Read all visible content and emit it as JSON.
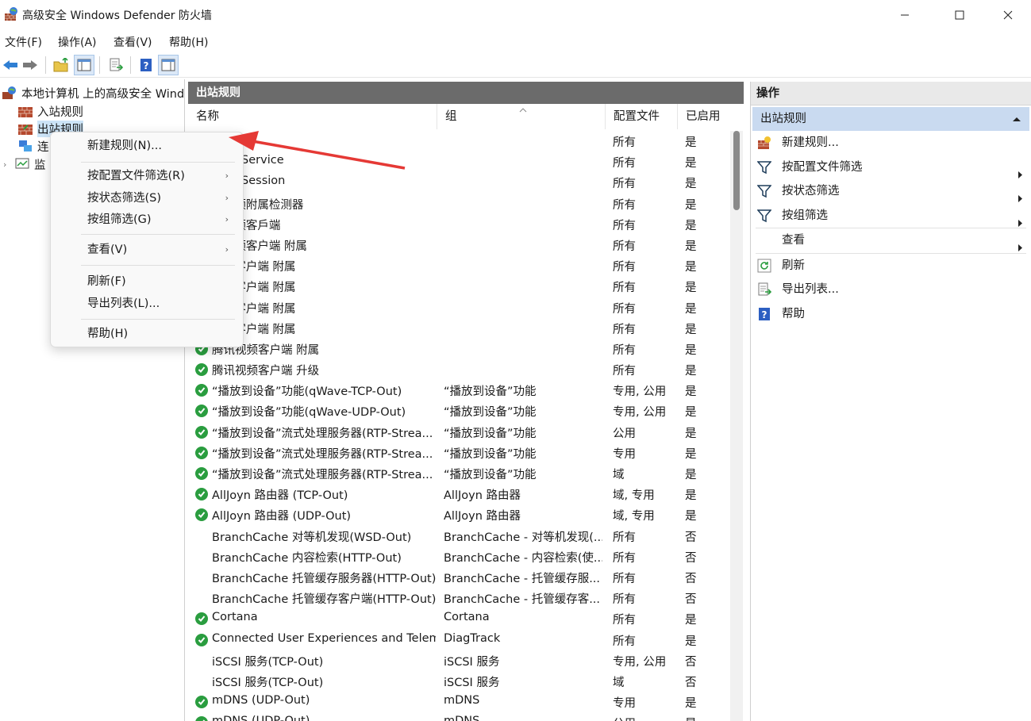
{
  "window": {
    "title": "高级安全 Windows Defender 防火墙",
    "minimize_icon": "minimize-icon",
    "maximize_icon": "maximize-icon",
    "close_icon": "close-icon"
  },
  "menubar": [
    "文件(F)",
    "操作(A)",
    "查看(V)",
    "帮助(H)"
  ],
  "toolbar": [
    "back-arrow-icon",
    "forward-arrow-icon",
    "up-folder-icon",
    "show-hide-tree-icon",
    "export-list-icon",
    "help-icon",
    "show-hide-action-pane-icon"
  ],
  "tree": {
    "root": "本地计算机 上的高级安全 Windows Defender 防火墙",
    "items": [
      "入站规则",
      "出站规则",
      "连接安全规则",
      "监视"
    ]
  },
  "center": {
    "title": "出站规则",
    "columns": [
      "名称",
      "组",
      "配置文件",
      "已启用"
    ],
    "rows": [
      {
        "name": "",
        "group": "",
        "profile": "所有",
        "enabled": "是",
        "check": false
      },
      {
        "name": "...sk_Service",
        "group": "",
        "profile": "所有",
        "enabled": "是",
        "check": false
      },
      {
        "name": "...sk_Session",
        "group": "",
        "profile": "所有",
        "enabled": "是",
        "check": false
      },
      {
        "name": "...视频附属检测器",
        "group": "",
        "profile": "所有",
        "enabled": "是",
        "check": false
      },
      {
        "name": "...视频客戶端",
        "group": "",
        "profile": "所有",
        "enabled": "是",
        "check": false
      },
      {
        "name": "...视频客户端 附属",
        "group": "",
        "profile": "所有",
        "enabled": "是",
        "check": false
      },
      {
        "name": "...频客户端 附属",
        "group": "",
        "profile": "所有",
        "enabled": "是",
        "check": false
      },
      {
        "name": "...频客户端 附属",
        "group": "",
        "profile": "所有",
        "enabled": "是",
        "check": false
      },
      {
        "name": "...频客户端 附属",
        "group": "",
        "profile": "所有",
        "enabled": "是",
        "check": false
      },
      {
        "name": "...频客户端 附属",
        "group": "",
        "profile": "所有",
        "enabled": "是",
        "check": false
      },
      {
        "name": "腾讯视频客户端 附属",
        "group": "",
        "profile": "所有",
        "enabled": "是",
        "check": true
      },
      {
        "name": "腾讯视频客户端 升级",
        "group": "",
        "profile": "所有",
        "enabled": "是",
        "check": true
      },
      {
        "name": "“播放到设备”功能(qWave-TCP-Out)",
        "group": "“播放到设备”功能",
        "profile": "专用, 公用",
        "enabled": "是",
        "check": true
      },
      {
        "name": "“播放到设备”功能(qWave-UDP-Out)",
        "group": "“播放到设备”功能",
        "profile": "专用, 公用",
        "enabled": "是",
        "check": true
      },
      {
        "name": "“播放到设备”流式处理服务器(RTP-Strea...",
        "group": "“播放到设备”功能",
        "profile": "公用",
        "enabled": "是",
        "check": true
      },
      {
        "name": "“播放到设备”流式处理服务器(RTP-Strea...",
        "group": "“播放到设备”功能",
        "profile": "专用",
        "enabled": "是",
        "check": true
      },
      {
        "name": "“播放到设备”流式处理服务器(RTP-Strea...",
        "group": "“播放到设备”功能",
        "profile": "域",
        "enabled": "是",
        "check": true
      },
      {
        "name": "AllJoyn 路由器 (TCP-Out)",
        "group": "AllJoyn 路由器",
        "profile": "域, 专用",
        "enabled": "是",
        "check": true
      },
      {
        "name": "AllJoyn 路由器 (UDP-Out)",
        "group": "AllJoyn 路由器",
        "profile": "域, 专用",
        "enabled": "是",
        "check": true
      },
      {
        "name": "BranchCache 对等机发现(WSD-Out)",
        "group": "BranchCache - 对等机发现(...",
        "profile": "所有",
        "enabled": "否",
        "check": false
      },
      {
        "name": "BranchCache 内容检索(HTTP-Out)",
        "group": "BranchCache - 内容检索(使...",
        "profile": "所有",
        "enabled": "否",
        "check": false
      },
      {
        "name": "BranchCache 托管缓存服务器(HTTP-Out)",
        "group": "BranchCache - 托管缓存服...",
        "profile": "所有",
        "enabled": "否",
        "check": false
      },
      {
        "name": "BranchCache 托管缓存客户端(HTTP-Out)",
        "group": "BranchCache - 托管缓存客...",
        "profile": "所有",
        "enabled": "否",
        "check": false
      },
      {
        "name": "Cortana",
        "group": "Cortana",
        "profile": "所有",
        "enabled": "是",
        "check": true
      },
      {
        "name": "Connected User Experiences and Telem...",
        "group": "DiagTrack",
        "profile": "所有",
        "enabled": "是",
        "check": true
      },
      {
        "name": "iSCSI 服务(TCP-Out)",
        "group": "iSCSI 服务",
        "profile": "专用, 公用",
        "enabled": "否",
        "check": false
      },
      {
        "name": "iSCSI 服务(TCP-Out)",
        "group": "iSCSI 服务",
        "profile": "域",
        "enabled": "否",
        "check": false
      },
      {
        "name": "mDNS (UDP-Out)",
        "group": "mDNS",
        "profile": "专用",
        "enabled": "是",
        "check": true
      },
      {
        "name": "mDNS (UDP-Out)",
        "group": "mDNS",
        "profile": "公用",
        "enabled": "是",
        "check": true
      }
    ]
  },
  "actions": {
    "title": "操作",
    "section": "出站规则",
    "items": [
      {
        "label": "新建规则...",
        "icon": "new-rule-icon",
        "submenu": false
      },
      {
        "label": "按配置文件筛选",
        "icon": "filter-icon",
        "submenu": true
      },
      {
        "label": "按状态筛选",
        "icon": "filter-icon",
        "submenu": true
      },
      {
        "label": "按组筛选",
        "icon": "filter-icon",
        "submenu": true
      },
      {
        "label": "查看",
        "icon": "",
        "submenu": true
      },
      {
        "label": "刷新",
        "icon": "refresh-icon",
        "submenu": false
      },
      {
        "label": "导出列表...",
        "icon": "export-list-icon",
        "submenu": false
      },
      {
        "label": "帮助",
        "icon": "help-icon",
        "submenu": false
      }
    ]
  },
  "context_menu": {
    "items": [
      "新建规则(N)...",
      "按配置文件筛选(R)",
      "按状态筛选(S)",
      "按组筛选(G)",
      "查看(V)",
      "刷新(F)",
      "导出列表(L)...",
      "帮助(H)"
    ]
  },
  "colors": {
    "panel_header": "#6b6b6b",
    "action_section": "#c9daf0",
    "check_green": "#2a9d3f",
    "annotation_arrow": "#e53935"
  }
}
